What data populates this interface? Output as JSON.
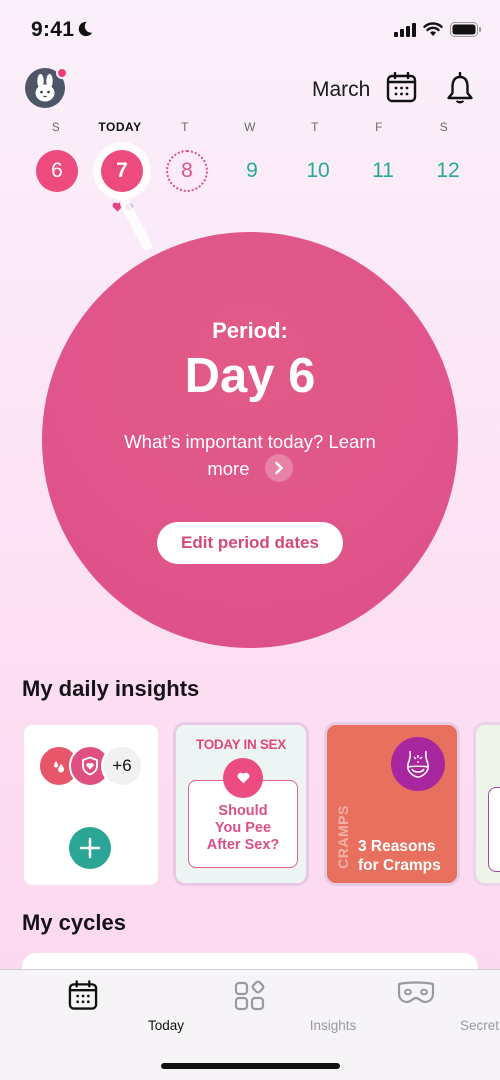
{
  "status_bar": {
    "time": "9:41",
    "icons": [
      "moon-icon",
      "signal-icon",
      "wifi-icon",
      "battery-icon"
    ]
  },
  "header": {
    "avatar_icon": "bunny-avatar",
    "has_notification_dot": true,
    "month": "March",
    "calendar_icon": "calendar-icon",
    "bell_icon": "bell-icon"
  },
  "week": {
    "days": [
      {
        "weekday": "S",
        "date": "6",
        "state": "period"
      },
      {
        "weekday": "TODAY",
        "date": "7",
        "state": "today"
      },
      {
        "weekday": "T",
        "date": "8",
        "state": "predicted"
      },
      {
        "weekday": "W",
        "date": "9",
        "state": "future"
      },
      {
        "weekday": "T",
        "date": "10",
        "state": "future"
      },
      {
        "weekday": "F",
        "date": "11",
        "state": "future"
      },
      {
        "weekday": "S",
        "date": "12",
        "state": "future"
      }
    ],
    "today_marks": [
      "heart-mark",
      "grey-dot-mark"
    ]
  },
  "period_card": {
    "label": "Period:",
    "day": "Day 6",
    "learn_text": "What’s important today? Learn more",
    "learn_text_line1": "What’s important today? Learn",
    "learn_text_line2": "more",
    "edit_button": "Edit period dates"
  },
  "insights": {
    "title": "My daily insights",
    "log_card": {
      "bubbles": [
        "drops-icon",
        "shield-heart-icon"
      ],
      "extra_count": "+6",
      "add_icon": "plus-icon"
    },
    "cards": [
      {
        "tag": "TODAY IN SEX",
        "title_lines": [
          "Should",
          "You Pee",
          "After Sex?"
        ],
        "icon": "heart-icon"
      },
      {
        "tag": "CRAMPS",
        "title_lines": [
          "3 Reasons",
          "for Cramps"
        ],
        "icon": "abdomen-icon"
      }
    ]
  },
  "cycles": {
    "title": "My cycles"
  },
  "tab_bar": {
    "tabs": [
      {
        "label": "Today",
        "icon": "calendar-icon",
        "active": true
      },
      {
        "label": "Insights",
        "icon": "grid-icon",
        "active": false
      },
      {
        "label": "Secret Chats",
        "icon": "mask-icon",
        "active": false
      }
    ]
  },
  "colors": {
    "accent_pink": "#ed4a7e",
    "circle_pink": "#e0558a",
    "teal": "#25a99a",
    "cramps_orange": "#e8705e",
    "cramps_purple": "#a8279e"
  }
}
